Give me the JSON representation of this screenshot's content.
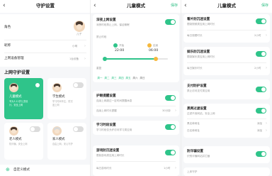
{
  "panel1": {
    "title": "守护设置",
    "back": "‹",
    "profile": {
      "label": "角色",
      "avatar_caption": "儿子"
    },
    "nickname": {
      "label": "昵称",
      "value": "小明"
    },
    "limit": {
      "label": "上网设备管理",
      "value": "1台设备"
    },
    "section_title": "上网守护设置",
    "modes": [
      {
        "title": "儿童模式",
        "desc": "专为3-12岁儿童设计，安全上网"
      },
      {
        "title": "学生模式",
        "desc": "学习时间专注，防沉迷上网"
      },
      {
        "title": "老人模式",
        "desc": "防诈骗，安全上网"
      },
      {
        "title": "家人模式",
        "desc": "自由上网，安心守护"
      }
    ],
    "footer": "自定义模式"
  },
  "panel2": {
    "title": "儿童模式",
    "action": "保存",
    "deep": {
      "title": "深夜上网设置",
      "desc": "深夜时段禁止上网，保证睡眠"
    },
    "time_label": "禁止时段",
    "start": {
      "label": "开始",
      "time": "22:00"
    },
    "end": {
      "label": "结束",
      "time": "06:00"
    },
    "repeat_label": "重复",
    "days": [
      "周一",
      "周二",
      "周三",
      "周四",
      "周五",
      "周六",
      "周日"
    ],
    "eye": {
      "title": "护眼提醒设置",
      "desc": "连续上网超过一定时间提醒休息"
    },
    "eye_row": {
      "label": "连续上网时长提醒",
      "value": "30分钟"
    },
    "study": {
      "title": "学习时段设置",
      "desc": "学习时段仅允许访问学习类应用"
    },
    "game": {
      "title": "游戏防沉迷设置",
      "desc": "限制游戏类应用上网时长"
    },
    "game_row": {
      "label": "每日游戏时长",
      "value": "1小时"
    }
  },
  "panel3": {
    "title": "儿童模式",
    "action": "保存",
    "video": {
      "title": "看片防沉迷设置",
      "desc": "限制视频类应用上网时长"
    },
    "video_row": {
      "label": "每日观看时长",
      "value": "2小时"
    },
    "social": {
      "title": "娱乐防沉迷设置",
      "desc": "限制娱乐类应用上网时长"
    },
    "social_row": {
      "label": "每日娱乐时长",
      "value": "2小时"
    },
    "pay": {
      "title": "支付防护设置",
      "desc": "禁止访问支付类应用"
    },
    "web": {
      "title": "黑网过滤设置",
      "desc": "过滤不良网站，安全上网"
    },
    "web_row1": {
      "label": "黑名单网址",
      "value": "添加"
    },
    "web_row2": {
      "label": "白名单网址",
      "value": "添加"
    },
    "anti": {
      "title": "防诈骗设置",
      "desc": "识别诈骗网站并拦截"
    },
    "footer": "上床守护"
  }
}
